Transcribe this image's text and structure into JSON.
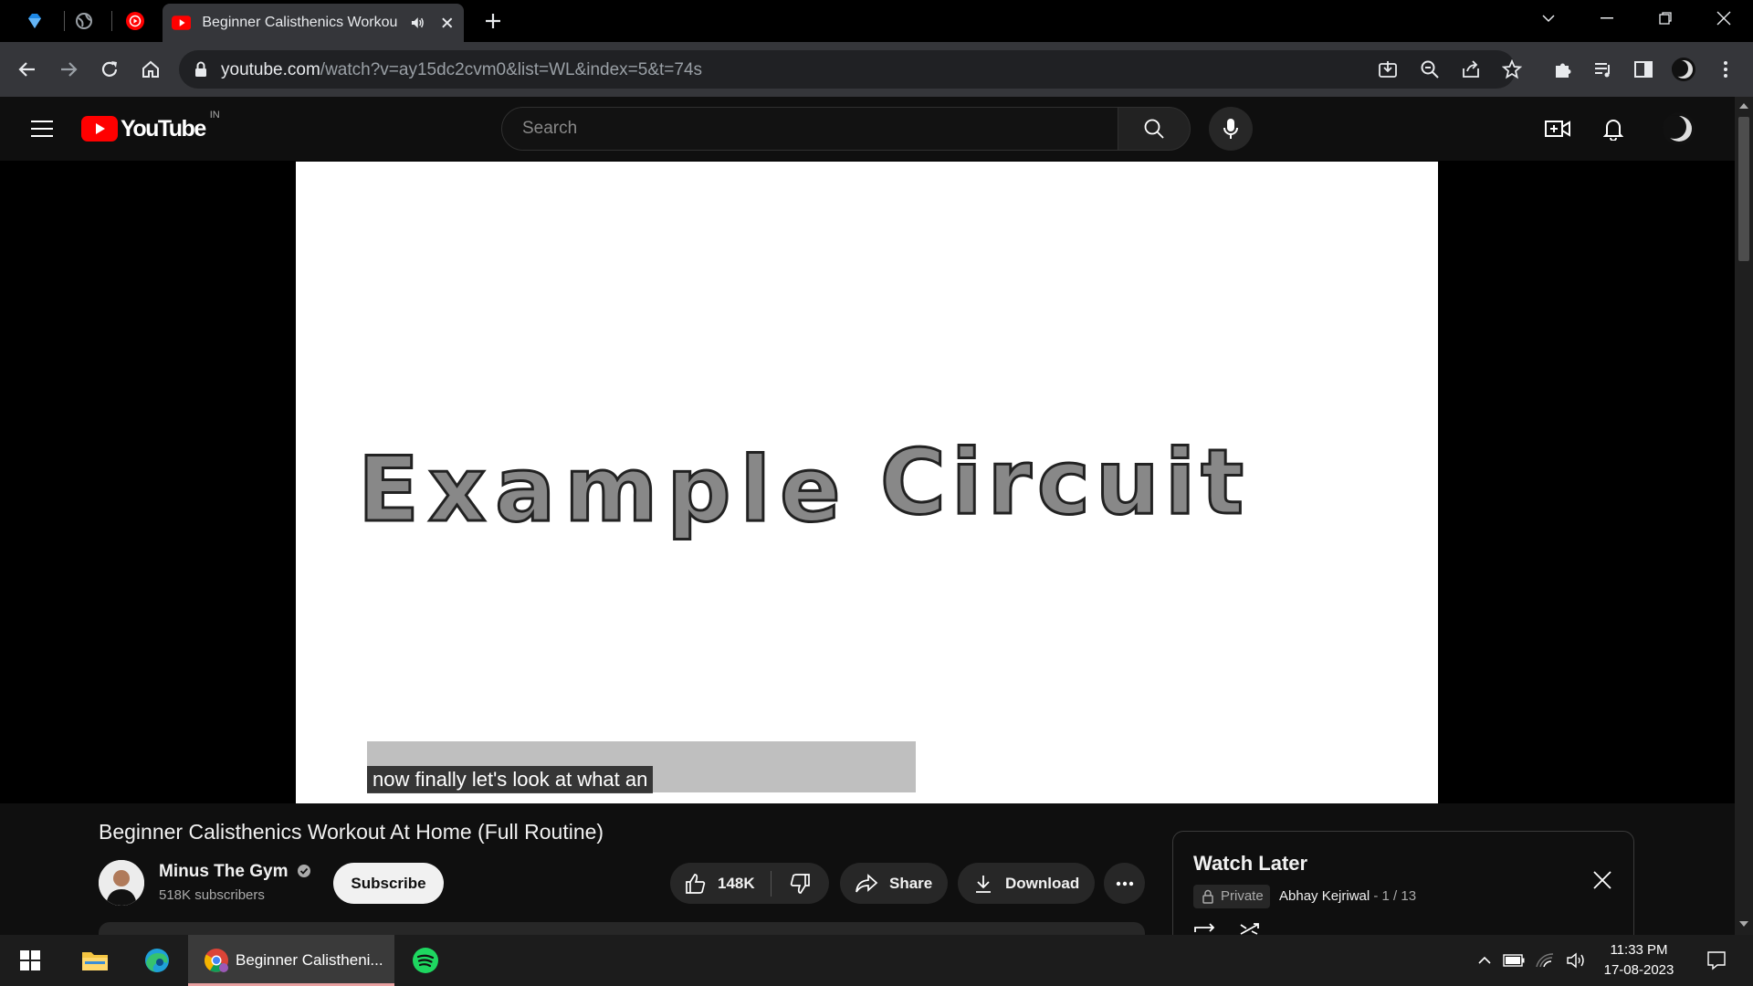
{
  "browser": {
    "active_tab_title": "Beginner Calisthenics Workout",
    "url_domain": "youtube.com",
    "url_path": "/watch?v=ay15dc2cvm0&list=WL&index=5&t=74s"
  },
  "youtube": {
    "logo_text": "YouTube",
    "country_code": "IN",
    "search_placeholder": "Search"
  },
  "video": {
    "frame_text_1": "Example",
    "frame_text_2": "Circuit",
    "caption": "now finally let's look at what an",
    "title": "Beginner Calisthenics Workout At Home (Full Routine)"
  },
  "channel": {
    "name": "Minus The Gym",
    "subscribers": "518K subscribers",
    "subscribe_label": "Subscribe"
  },
  "actions": {
    "like_count": "148K",
    "share_label": "Share",
    "download_label": "Download"
  },
  "playlist": {
    "title": "Watch Later",
    "privacy": "Private",
    "owner": "Abhay Kejriwal",
    "position": " - 1 / 13"
  },
  "taskbar": {
    "chrome_label": "Beginner Calistheni...",
    "time": "11:33 PM",
    "date": "17-08-2023"
  },
  "colors": {
    "youtube_red": "#ff0000",
    "tab_bg": "#35363a",
    "page_bg": "#0f0f0f",
    "spotify_green": "#1ed760"
  }
}
